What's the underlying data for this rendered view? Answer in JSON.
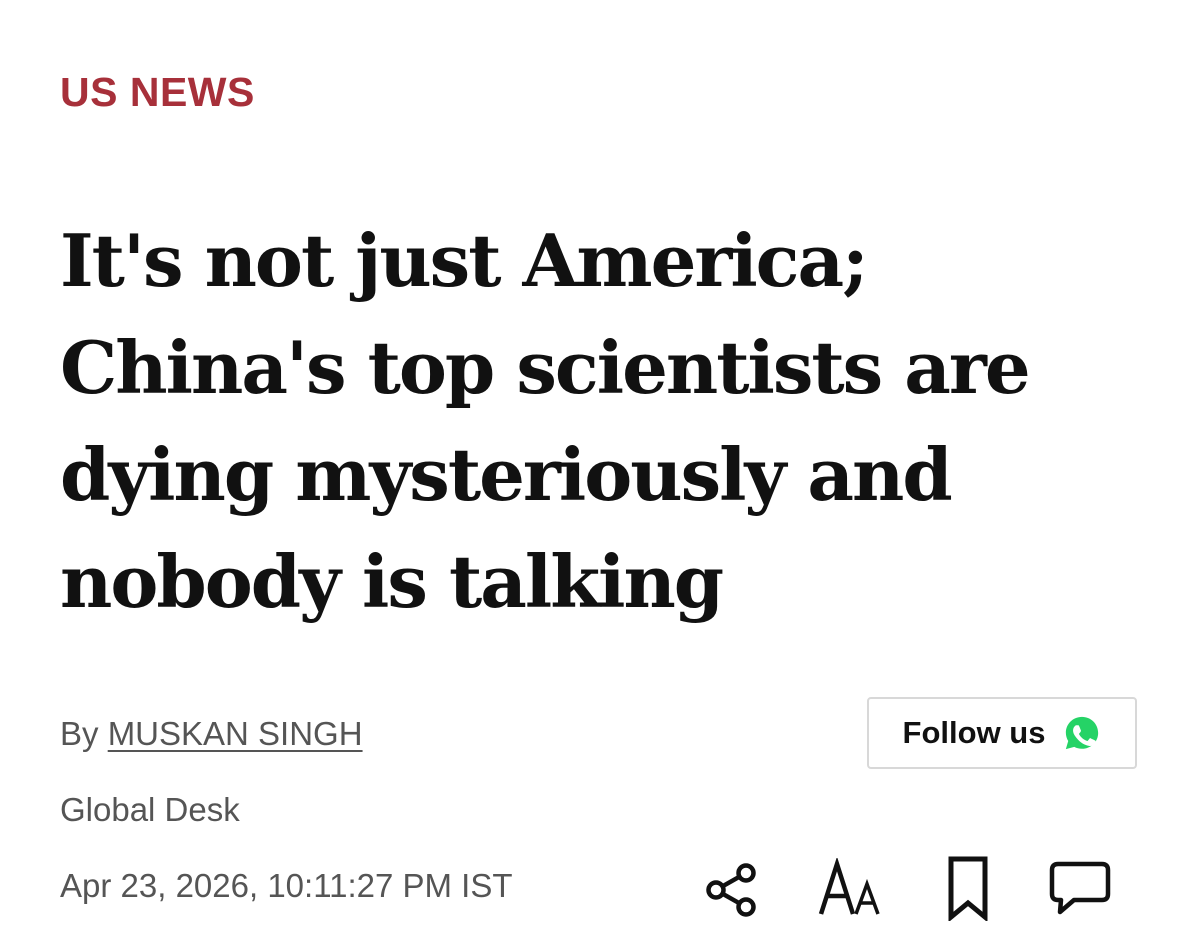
{
  "article": {
    "category": "US NEWS",
    "headline_lines": [
      "It's not just America;",
      "China's top scientists are",
      "dying mysteriously and",
      "nobody is talking"
    ],
    "byline_prefix": "By",
    "author": "MUSKAN SINGH",
    "desk": "Global Desk",
    "timestamp": "Apr 23, 2026, 10:11:27 PM IST"
  },
  "follow_button": {
    "label": "Follow us",
    "icon": "whatsapp-icon"
  },
  "toolbar": {
    "icons": [
      "share-icon",
      "font-size-icon",
      "bookmark-icon",
      "comment-icon"
    ]
  },
  "colors": {
    "category": "#a7303a",
    "headline": "#111111",
    "meta_text": "#555555",
    "whatsapp_green": "#25d366",
    "button_border": "#d8d8d8"
  }
}
